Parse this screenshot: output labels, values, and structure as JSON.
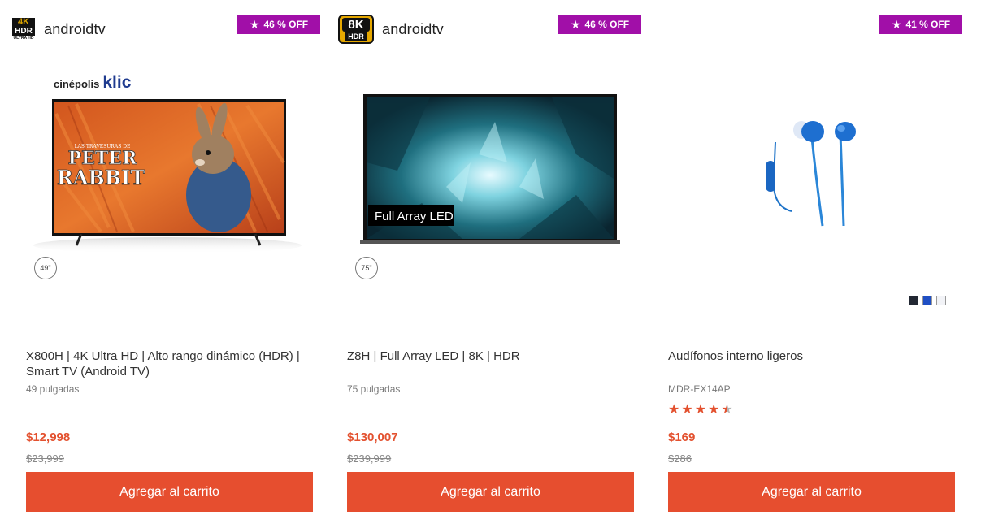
{
  "colors": {
    "accent": "#e64e2f",
    "price": "#e3512f",
    "discount_badge": "#a10fa8"
  },
  "products": [
    {
      "res_badge": {
        "line1": "4K",
        "line2": "HDR",
        "line3": "ULTRA HD"
      },
      "platform": "androidtv",
      "discount": "46 % OFF",
      "brand_partner": "cinépolis",
      "brand_partner_suffix": "klic",
      "image_title_line1": "LAS TRAVESURAS DE",
      "image_title_line2": "PETER",
      "image_title_line3": "RABBIT",
      "size_badge": "49\"",
      "title": "X800H | 4K Ultra HD | Alto rango dinámico (HDR) | Smart TV (Android TV)",
      "subtitle": "49 pulgadas",
      "price": "$12,998",
      "old_price": "$23,999",
      "button_label": "Agregar al carrito"
    },
    {
      "res_badge": {
        "line1": "8K",
        "line2": "HDR"
      },
      "platform": "androidtv",
      "discount": "46 % OFF",
      "image_label": "Full Array LED",
      "size_badge": "75\"",
      "title": "Z8H | Full Array LED | 8K | HDR",
      "subtitle": "75 pulgadas",
      "price": "$130,007",
      "old_price": "$239,999",
      "button_label": "Agregar al carrito"
    },
    {
      "discount": "41 % OFF",
      "swatches": [
        "#222833",
        "#1f4fc4",
        "#f2f3f7"
      ],
      "title": "Audífonos interno ligeros",
      "subtitle": "MDR-EX14AP",
      "rating_stars": 4.5,
      "price": "$169",
      "old_price": "$286",
      "button_label": "Agregar al carrito"
    }
  ]
}
